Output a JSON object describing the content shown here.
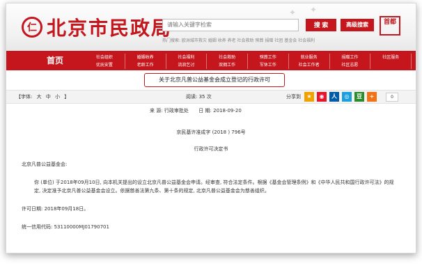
{
  "header": {
    "emblem_char": "仁",
    "logo_text": "北京市民政局",
    "search_placeholder": "请输入关键字检索",
    "hot_searches": "热门搜索: 欧洲城市救灾  婚姻  收养  养老  社会救助  殡葬  捐赠  社团  基金会  社会福利",
    "search_button": "搜 索",
    "advanced_button": "高级搜索",
    "badge_text": "首都"
  },
  "nav": {
    "home": "首页",
    "items": [
      "社会组织",
      "婚姻收养",
      "社会福利",
      "社会救助",
      "殡葬工作",
      "就业服务",
      "捐赠工作",
      "社区服务",
      "优抚安置",
      "老龄工作",
      "流浪乞讨",
      "双拥工作",
      "军休工作",
      "社会工作者",
      "社区志愿",
      ""
    ]
  },
  "article": {
    "title": "关于北京凡普公益基金会成立登记的行政许可",
    "reads": "阅读: 35 次",
    "source_label": "来 源:",
    "source_value": "行政审批处",
    "date_label": "日 期:",
    "date_value": "2018-09-20",
    "doc_no": "京民基许准成字 (2018 ) 796号",
    "doc_title": "行政许可决定书",
    "addressee": "北京凡普公益基金会:",
    "body_indent": "你 (单位) 于2018年09月10日, 向本机关提出的设立北京凡普公益基金会申请。经审查, 符合法定条件。根据《基金会管理条例》和《中华人民共和国行政许可法》的规定, 决定准予北京凡普公益基金会设立。依据慈善法第九条、第十条的规定, 北京凡普公益基金会为慈善组织。",
    "permit_date": "许可日期: 2018年09月18日。",
    "credit_code": "统一信用代码: 53110000MJ01790701"
  },
  "toolbar": {
    "font_label": "【字体:",
    "font_large": "大",
    "font_medium": "中",
    "font_small": "小",
    "font_close": "】",
    "share_label": "分享到",
    "share_count": "0"
  },
  "share_icons": [
    {
      "name": "qzone-icon",
      "color": "#f0a200",
      "glyph": "★"
    },
    {
      "name": "weibo-icon",
      "color": "#e6162d",
      "glyph": "◉"
    },
    {
      "name": "renren-icon",
      "color": "#005baa",
      "glyph": "人"
    },
    {
      "name": "tencent-weibo-icon",
      "color": "#1a9fdf",
      "glyph": "◎"
    },
    {
      "name": "douban-icon",
      "color": "#2b8c2b",
      "glyph": "豆"
    },
    {
      "name": "more-share-icon",
      "color": "#f47216",
      "glyph": "+"
    }
  ],
  "colors": {
    "brand_red": "#c4161c"
  }
}
